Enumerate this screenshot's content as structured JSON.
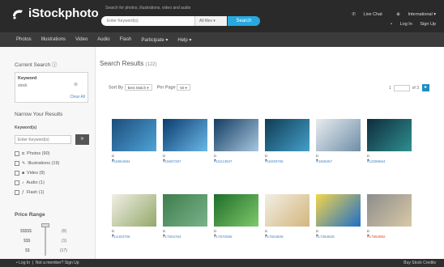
{
  "header": {
    "logo_text": "iStockphoto",
    "search_hint": "Search for photos, illustrations, video and audio",
    "search_placeholder": "Enter Keyword(s)",
    "search_filter": "All files ▾",
    "search_button": "Search",
    "live_chat": "Live Chat",
    "region": "International ▾",
    "login": "Log In",
    "signup": "Sign Up"
  },
  "nav": [
    "Photos",
    "Illustrations",
    "Video",
    "Audio",
    "Flash",
    "Participate ▾",
    "Help ▾"
  ],
  "sidebar": {
    "current_search_title": "Current Search ⓘ",
    "keyword_label": "Keyword",
    "keyword_value": "stock",
    "clear_all": "Clear All",
    "narrow_title": "Narrow Your Results",
    "keywords_label": "Keyword(s)",
    "keywords_placeholder": "Enter Keyword(s)",
    "keywords_go": "»",
    "file_types": [
      {
        "icon": "camera-icon",
        "label": "Photos (90)"
      },
      {
        "icon": "pen-icon",
        "label": "Illustrations (19)"
      },
      {
        "icon": "video-icon",
        "label": "Video (9)"
      },
      {
        "icon": "music-note-icon",
        "label": "Audio (1)"
      },
      {
        "icon": "flash-icon",
        "label": "Flash (1)"
      }
    ],
    "price_title": "Price Range",
    "price_rows": [
      {
        "label": "$$$$$",
        "count": "(0)"
      },
      {
        "label": "$$$",
        "count": "(1)"
      },
      {
        "label": "$$",
        "count": "(17)"
      }
    ]
  },
  "main": {
    "title": "Search Results",
    "count": "(122)",
    "sort_label": "Sort By",
    "sort_value": "Best Match",
    "per_page_label": "Per Page",
    "per_page_value": "50",
    "page_current": "1",
    "page_of": "of 3",
    "next": "▸"
  },
  "results": [
    {
      "id": "#15854684",
      "colors": [
        "#1b4d7a",
        "#4fa3d8"
      ]
    },
    {
      "id": "#15697287",
      "colors": [
        "#0a3c6e",
        "#6ab8e8"
      ]
    },
    {
      "id": "#15213937",
      "colors": [
        "#123c62",
        "#a9c7de"
      ]
    },
    {
      "id": "#15039706",
      "colors": [
        "#0f3b54",
        "#44a0c8"
      ]
    },
    {
      "id": "#4469257",
      "colors": [
        "#e8ecef",
        "#6f8ea8"
      ]
    },
    {
      "id": "#12096664",
      "colors": [
        "#0e2c3c",
        "#2f8f8f"
      ]
    },
    {
      "id": "#14403706",
      "colors": [
        "#f1efe6",
        "#94a869"
      ]
    },
    {
      "id": "#17504764",
      "colors": [
        "#3e7d4c",
        "#79b38a"
      ]
    },
    {
      "id": "#17870055",
      "colors": [
        "#1e6e2a",
        "#7fc86a"
      ]
    },
    {
      "id": "#17604828",
      "colors": [
        "#f3eee4",
        "#d2b67c"
      ]
    },
    {
      "id": "#17394829",
      "colors": [
        "#f4d54a",
        "#1e6fc9"
      ]
    },
    {
      "id": "#17994982",
      "colors": [
        "#8d8d8d",
        "#d9c9a6"
      ]
    }
  ],
  "footer": {
    "login": "• Log In",
    "not_member": "Not a member? Sign Up",
    "credits": "Buy Stock Credits"
  }
}
